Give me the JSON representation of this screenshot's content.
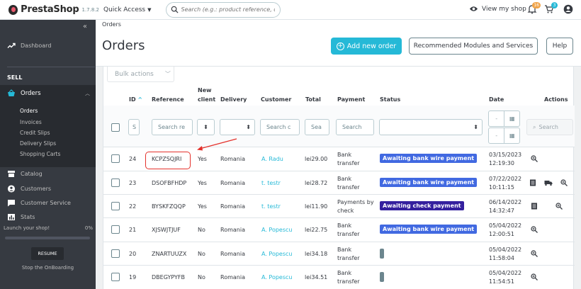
{
  "header": {
    "logo_text": "PrestaShop",
    "version": "1.7.8.2",
    "quick_access": "Quick Access",
    "search_placeholder": "Search (e.g.: product reference, custon",
    "view_shop": "View my shop",
    "notif_badge_1": "16",
    "notif_badge_2": "3"
  },
  "sidebar": {
    "dashboard": "Dashboard",
    "sell_label": "SELL",
    "orders": "Orders",
    "orders_sub": [
      "Orders",
      "Invoices",
      "Credit Slips",
      "Delivery Slips",
      "Shopping Carts"
    ],
    "catalog": "Catalog",
    "customers": "Customers",
    "customer_service": "Customer Service",
    "stats": "Stats",
    "launch_label": "Launch your shop!",
    "launch_percent": "0%",
    "launch_progress": 0,
    "resume": "RESUME",
    "stop": "Stop the OnBoarding"
  },
  "page": {
    "breadcrumb": "Orders",
    "title": "Orders",
    "add_button": "Add new order",
    "recommended_button": "Recommended Modules and Services",
    "help_button": "Help",
    "bulk_actions": "Bulk actions"
  },
  "columns": {
    "id": "ID",
    "reference": "Reference",
    "new_client_1": "New",
    "new_client_2": "client",
    "delivery": "Delivery",
    "customer": "Customer",
    "total": "Total",
    "payment": "Payment",
    "status": "Status",
    "date": "Date",
    "actions": "Actions"
  },
  "filters": {
    "id": "S",
    "reference": "Search re",
    "customer": "Search c",
    "total": "Sea",
    "payment": "Search",
    "search_button": "Search"
  },
  "orders": [
    {
      "id": "24",
      "reference": "KCPZSQJRI",
      "new_client": "Yes",
      "delivery": "Romania",
      "customer": "A. Radu",
      "total": "lei29.00",
      "payment_1": "Bank",
      "payment_2": "transfer",
      "status": "Awaiting bank wire payment",
      "status_color": "#4169e1",
      "date_1": "03/15/2023",
      "date_2": "12:19:30"
    },
    {
      "id": "23",
      "reference": "DSOFBFHDP",
      "new_client": "Yes",
      "delivery": "Romania",
      "customer": "t. testr",
      "total": "lei28.72",
      "payment_1": "Bank",
      "payment_2": "transfer",
      "status": "Awaiting bank wire payment",
      "status_color": "#4169e1",
      "date_1": "07/22/2022",
      "date_2": "10:11:15"
    },
    {
      "id": "22",
      "reference": "BYSKFZQQP",
      "new_client": "Yes",
      "delivery": "Romania",
      "customer": "t. testr",
      "total": "lei11.90",
      "payment_1": "Payments by",
      "payment_2": "check",
      "status": "Awaiting check payment",
      "status_color": "#34209e",
      "date_1": "06/14/2022",
      "date_2": "14:32:47"
    },
    {
      "id": "21",
      "reference": "XJSWJTJUF",
      "new_client": "No",
      "delivery": "Romania",
      "customer": "A. Popescu",
      "total": "lei22.75",
      "payment_1": "Bank",
      "payment_2": "transfer",
      "status": "Awaiting bank wire payment",
      "status_color": "#4169e1",
      "date_1": "05/04/2022",
      "date_2": "12:00:51"
    },
    {
      "id": "20",
      "reference": "ZNARTUUZX",
      "new_client": "No",
      "delivery": "Romania",
      "customer": "A. Popescu",
      "total": "lei34.18",
      "payment_1": "Bank",
      "payment_2": "transfer",
      "status": "",
      "status_color": "#6c868e",
      "date_1": "05/04/2022",
      "date_2": "11:58:04"
    },
    {
      "id": "19",
      "reference": "DBEGYPYFB",
      "new_client": "No",
      "delivery": "Romania",
      "customer": "A. Popescu",
      "total": "lei34.51",
      "payment_1": "Bank",
      "payment_2": "transfer",
      "status": "",
      "status_color": "#6c868e",
      "date_1": "05/04/2022",
      "date_2": "11:54:51"
    }
  ],
  "colors": {
    "accent": "#25b9d7",
    "sidebar": "#363a41",
    "annotation": "#e4312b",
    "badge_orange": "#f0a44a",
    "badge_blue": "#25b9d7"
  }
}
